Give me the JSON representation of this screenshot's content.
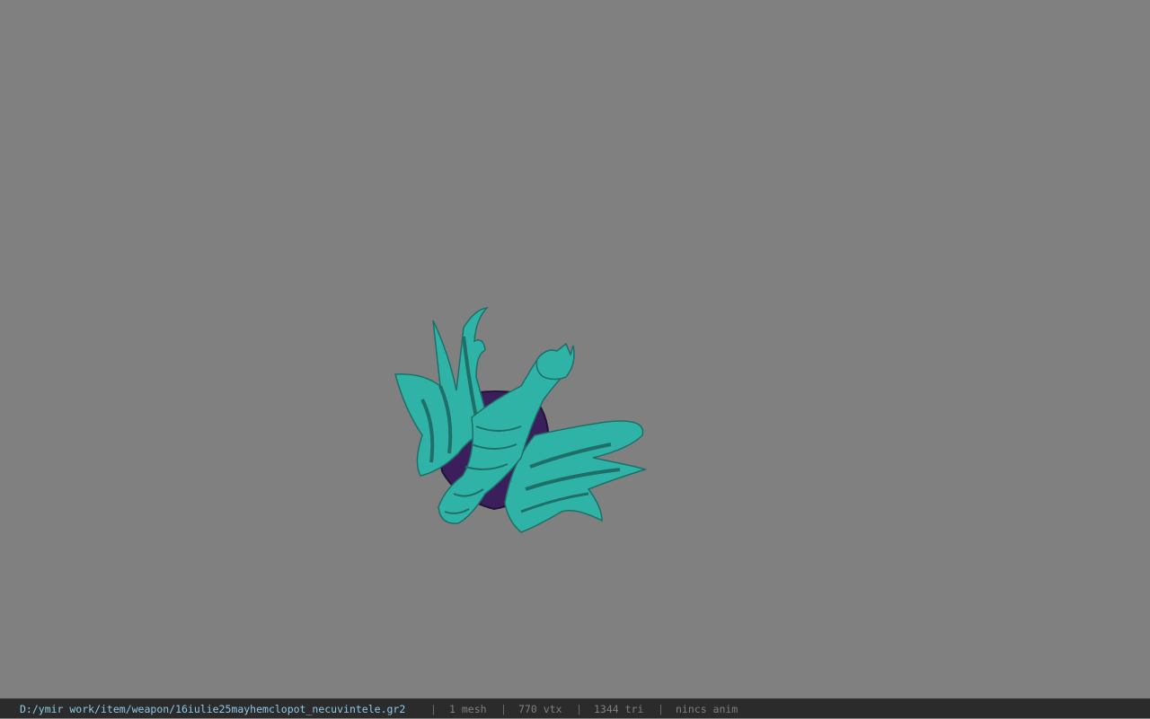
{
  "viewer": {
    "background_color": "#808080",
    "model": {
      "icon": "dragon-weapon-model",
      "primary_color": "#2fb3a6",
      "stripe_color": "#1f6f69",
      "base_color": "#3b1f5c"
    }
  },
  "statusbar": {
    "file_path": "D:/ymir work/item/weapon/16iulie25mayhemclopot_necuvintele.gr2",
    "separator": "|",
    "mesh_count": "1 mesh",
    "vertex_count": "770 vtx",
    "triangle_count": "1344 tri",
    "anim_status": "nincs anim",
    "path_color": "#8ec9e6",
    "text_color": "#7f7f7f"
  }
}
